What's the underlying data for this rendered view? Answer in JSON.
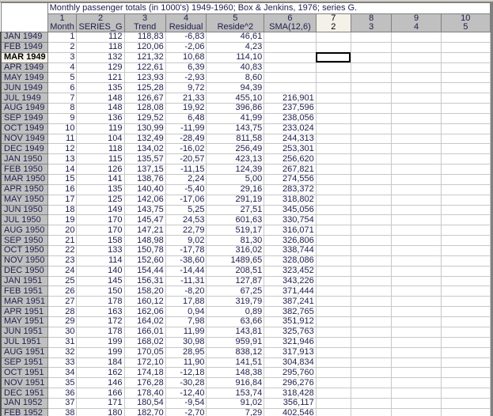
{
  "title": "Monthly passenger totals (in 1000's) 1949-1960; Box & Jenkins, 1976; series G.",
  "columns": [
    {
      "num": "1",
      "name": "Month"
    },
    {
      "num": "2",
      "name": "SERIES_G"
    },
    {
      "num": "3",
      "name": "Trend"
    },
    {
      "num": "4",
      "name": "Residual"
    },
    {
      "num": "5",
      "name": "Reside^2"
    },
    {
      "num": "6",
      "name": "SMA(12,6)"
    },
    {
      "num": "7",
      "name": "2"
    },
    {
      "num": "8",
      "name": "3"
    },
    {
      "num": "9",
      "name": "4"
    },
    {
      "num": "10",
      "name": "5"
    }
  ],
  "selected_row": "MAR 1949",
  "active_column": "7",
  "rows": [
    [
      "JAN 1949",
      "1",
      "112",
      "118,83",
      "-6,83",
      "46,61",
      ""
    ],
    [
      "FEB 1949",
      "2",
      "118",
      "120,06",
      "-2,06",
      "4,23",
      ""
    ],
    [
      "MAR 1949",
      "3",
      "132",
      "121,32",
      "10,68",
      "114,10",
      ""
    ],
    [
      "APR 1949",
      "4",
      "129",
      "122,61",
      "6,39",
      "40,83",
      ""
    ],
    [
      "MAY 1949",
      "5",
      "121",
      "123,93",
      "-2,93",
      "8,60",
      ""
    ],
    [
      "JUN 1949",
      "6",
      "135",
      "125,28",
      "9,72",
      "94,39",
      ""
    ],
    [
      "JUL 1949",
      "7",
      "148",
      "126,67",
      "21,33",
      "455,10",
      "216,901"
    ],
    [
      "AUG 1949",
      "8",
      "148",
      "128,08",
      "19,92",
      "396,86",
      "237,596"
    ],
    [
      "SEP 1949",
      "9",
      "136",
      "129,52",
      "6,48",
      "41,99",
      "238,056"
    ],
    [
      "OCT 1949",
      "10",
      "119",
      "130,99",
      "-11,99",
      "143,75",
      "233,024"
    ],
    [
      "NOV 1949",
      "11",
      "104",
      "132,49",
      "-28,49",
      "811,58",
      "244,313"
    ],
    [
      "DEC 1949",
      "12",
      "118",
      "134,02",
      "-16,02",
      "256,49",
      "253,301"
    ],
    [
      "JAN 1950",
      "13",
      "115",
      "135,57",
      "-20,57",
      "423,13",
      "256,620"
    ],
    [
      "FEB 1950",
      "14",
      "126",
      "137,15",
      "-11,15",
      "124,39",
      "267,821"
    ],
    [
      "MAR 1950",
      "15",
      "141",
      "138,76",
      "2,24",
      "5,00",
      "274,556"
    ],
    [
      "APR 1950",
      "16",
      "135",
      "140,40",
      "-5,40",
      "29,16",
      "283,372"
    ],
    [
      "MAY 1950",
      "17",
      "125",
      "142,06",
      "-17,06",
      "291,19",
      "318,802"
    ],
    [
      "JUN 1950",
      "18",
      "149",
      "143,75",
      "5,25",
      "27,51",
      "345,056"
    ],
    [
      "JUL 1950",
      "19",
      "170",
      "145,47",
      "24,53",
      "601,63",
      "330,754"
    ],
    [
      "AUG 1950",
      "20",
      "170",
      "147,21",
      "22,79",
      "519,17",
      "316,071"
    ],
    [
      "SEP 1950",
      "21",
      "158",
      "148,98",
      "9,02",
      "81,30",
      "326,806"
    ],
    [
      "OCT 1950",
      "22",
      "133",
      "150,78",
      "-17,78",
      "316,02",
      "338,744"
    ],
    [
      "NOV 1950",
      "23",
      "114",
      "152,60",
      "-38,60",
      "1489,65",
      "328,086"
    ],
    [
      "DEC 1950",
      "24",
      "140",
      "154,44",
      "-14,44",
      "208,51",
      "323,452"
    ],
    [
      "JAN 1951",
      "25",
      "145",
      "156,31",
      "-11,31",
      "127,87",
      "343,226"
    ],
    [
      "FEB 1951",
      "26",
      "150",
      "158,20",
      "-8,20",
      "67,25",
      "371,444"
    ],
    [
      "MAR 1951",
      "27",
      "178",
      "160,12",
      "17,88",
      "319,79",
      "387,241"
    ],
    [
      "APR 1951",
      "28",
      "163",
      "162,06",
      "0,94",
      "0,89",
      "382,765"
    ],
    [
      "MAY 1951",
      "29",
      "172",
      "164,02",
      "7,98",
      "63,66",
      "351,912"
    ],
    [
      "JUN 1951",
      "30",
      "178",
      "166,01",
      "11,99",
      "143,81",
      "325,763"
    ],
    [
      "JUL 1951",
      "31",
      "199",
      "168,02",
      "30,98",
      "959,91",
      "321,946"
    ],
    [
      "AUG 1951",
      "32",
      "199",
      "170,05",
      "28,95",
      "838,12",
      "317,913"
    ],
    [
      "SEP 1951",
      "33",
      "184",
      "172,10",
      "11,90",
      "141,51",
      "304,834"
    ],
    [
      "OCT 1951",
      "34",
      "162",
      "174,18",
      "-12,18",
      "148,38",
      "295,760"
    ],
    [
      "NOV 1951",
      "35",
      "146",
      "176,28",
      "-30,28",
      "916,84",
      "296,276"
    ],
    [
      "DEC 1951",
      "36",
      "166",
      "178,40",
      "-12,40",
      "153,74",
      "318,428"
    ],
    [
      "JAN 1952",
      "37",
      "171",
      "180,54",
      "-9,54",
      "91,02",
      "356,117"
    ],
    [
      "FEB 1952",
      "38",
      "180",
      "182,70",
      "-2,70",
      "7,29",
      "402,546"
    ]
  ]
}
